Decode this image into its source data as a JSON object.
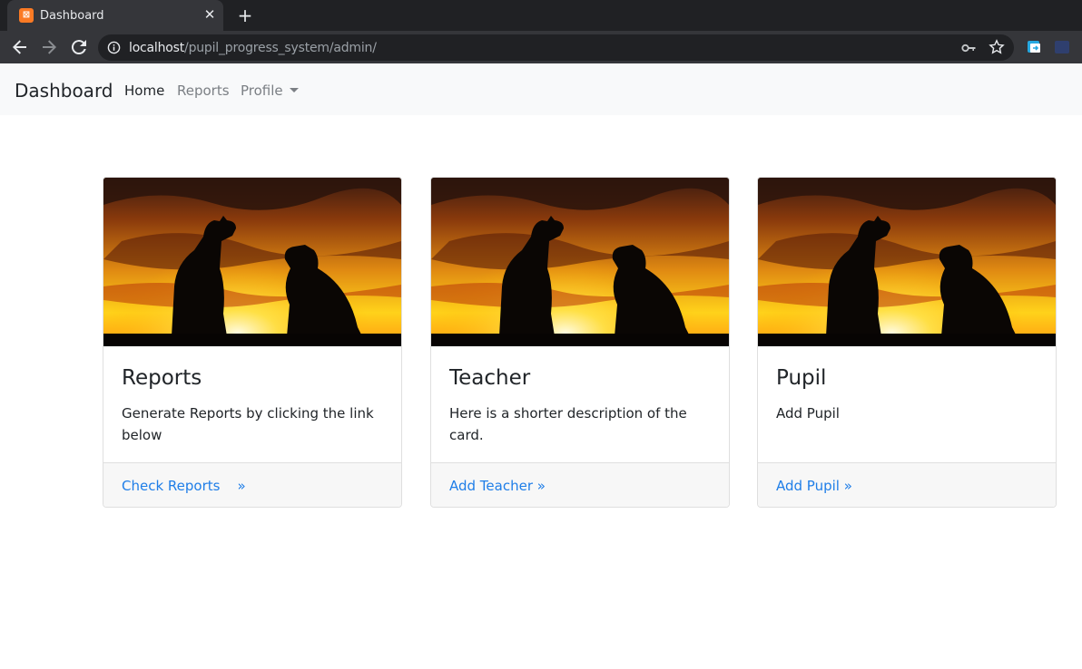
{
  "browser": {
    "tab_title": "Dashboard",
    "favicon_text": "⊠",
    "close_glyph": "✕",
    "new_tab_glyph": "+",
    "url_host": "localhost",
    "url_path": "/pupil_progress_system/admin/"
  },
  "navbar": {
    "brand": "Dashboard",
    "links": [
      {
        "label": "Home",
        "active": true
      },
      {
        "label": "Reports",
        "active": false
      },
      {
        "label": "Profile",
        "active": false
      }
    ]
  },
  "cards": [
    {
      "title": "Reports",
      "text": "Generate Reports by clicking the link below",
      "link": "Check Reports    »"
    },
    {
      "title": "Teacher",
      "text": "Here is a shorter description of the card.",
      "link": "Add Teacher »"
    },
    {
      "title": "Pupil",
      "text": "Add Pupil",
      "link": "Add Pupil »"
    }
  ],
  "colors": {
    "tab_strip": "#202124",
    "toolbar": "#35363a",
    "navbar_bg": "#f8f9fa",
    "link": "#1f7ee8",
    "card_footer": "#f7f7f7"
  }
}
